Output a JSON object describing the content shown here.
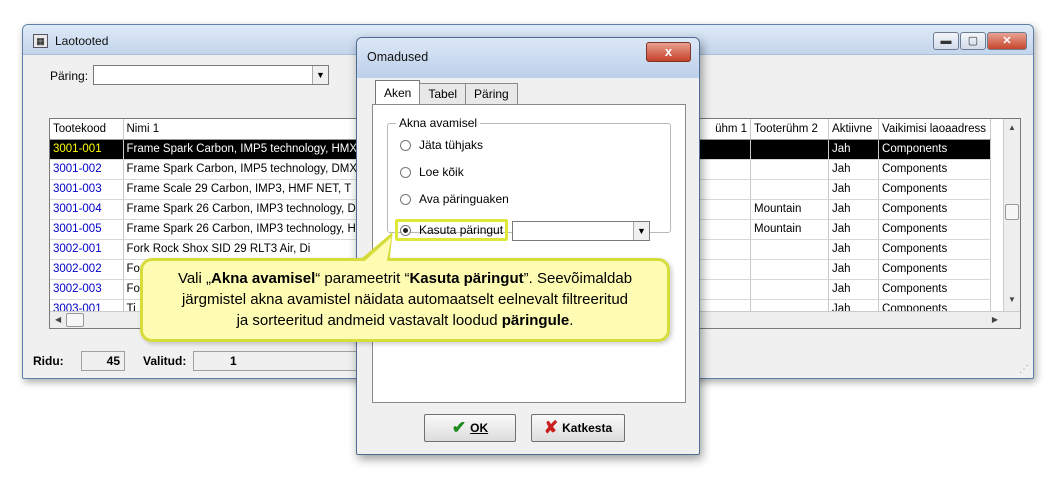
{
  "main_window": {
    "title": "Laotooted",
    "query_label": "Päring:",
    "query_value": "",
    "columns": [
      "Tootekood",
      "Nimi 1",
      "ühm 1",
      "Tooterühm 2",
      "Aktiivne",
      "Vaikimisi laoaadress"
    ],
    "rows": [
      {
        "code": "3001-001",
        "name": "Frame Spark Carbon, IMP5 technology, HMX",
        "g1": "",
        "g2": "",
        "active": "Jah",
        "addr": "Components"
      },
      {
        "code": "3001-002",
        "name": "Frame Spark Carbon, IMP5 technology, DMX",
        "g1": "",
        "g2": "",
        "active": "Jah",
        "addr": "Components"
      },
      {
        "code": "3001-003",
        "name": "Frame Scale 29 Carbon, IMP3, HMF NET, T",
        "g1": "",
        "g2": "",
        "active": "Jah",
        "addr": "Components"
      },
      {
        "code": "3001-004",
        "name": "Frame Spark 26 Carbon, IMP3 technology, D",
        "g1": "",
        "g2": "Mountain",
        "active": "Jah",
        "addr": "Components"
      },
      {
        "code": "3001-005",
        "name": "Frame Spark 26 Carbon, IMP3 technology, H",
        "g1": "",
        "g2": "Mountain",
        "active": "Jah",
        "addr": "Components"
      },
      {
        "code": "3002-001",
        "name": "Fork Rock Shox SID 29 RLT3 Air, Di",
        "g1": "",
        "g2": "",
        "active": "Jah",
        "addr": "Components"
      },
      {
        "code": "3002-002",
        "name": "Fork Rock Shox SID",
        "g1": "",
        "g2": "",
        "active": "Jah",
        "addr": "Components"
      },
      {
        "code": "3002-003",
        "name": "Fo",
        "g1": "",
        "g2": "",
        "active": "Jah",
        "addr": "Components"
      },
      {
        "code": "3003-001",
        "name": "Ti",
        "g1": "",
        "g2": "",
        "active": "Jah",
        "addr": "Components"
      }
    ],
    "status": {
      "rows_label": "Ridu:",
      "rows_value": "45",
      "selected_label": "Valitud:",
      "selected_value": "1"
    }
  },
  "dialog": {
    "title": "Omadused",
    "close_label": "x",
    "tabs": [
      "Aken",
      "Tabel",
      "Päring"
    ],
    "group_label": "Akna avamisel",
    "options": [
      "Jäta tühjaks",
      "Loe kõik",
      "Ava päringuaken",
      "Kasuta päringut"
    ],
    "query_value": "",
    "ok_label": "OK",
    "cancel_label": "Katkesta"
  },
  "tooltip": {
    "p1": "Vali „",
    "b1": "Akna avamisel",
    "p2": "“ parameetrit “",
    "b2": "Kasuta päringut",
    "p3": "”. Seevõimaldab",
    "line2": "järgmistel akna avamistel näidata automaatselt eelnevalt filtreeritud",
    "p4": "ja sorteeritud andmeid vastavalt loodud ",
    "b3": "päringule",
    "p5": "."
  }
}
